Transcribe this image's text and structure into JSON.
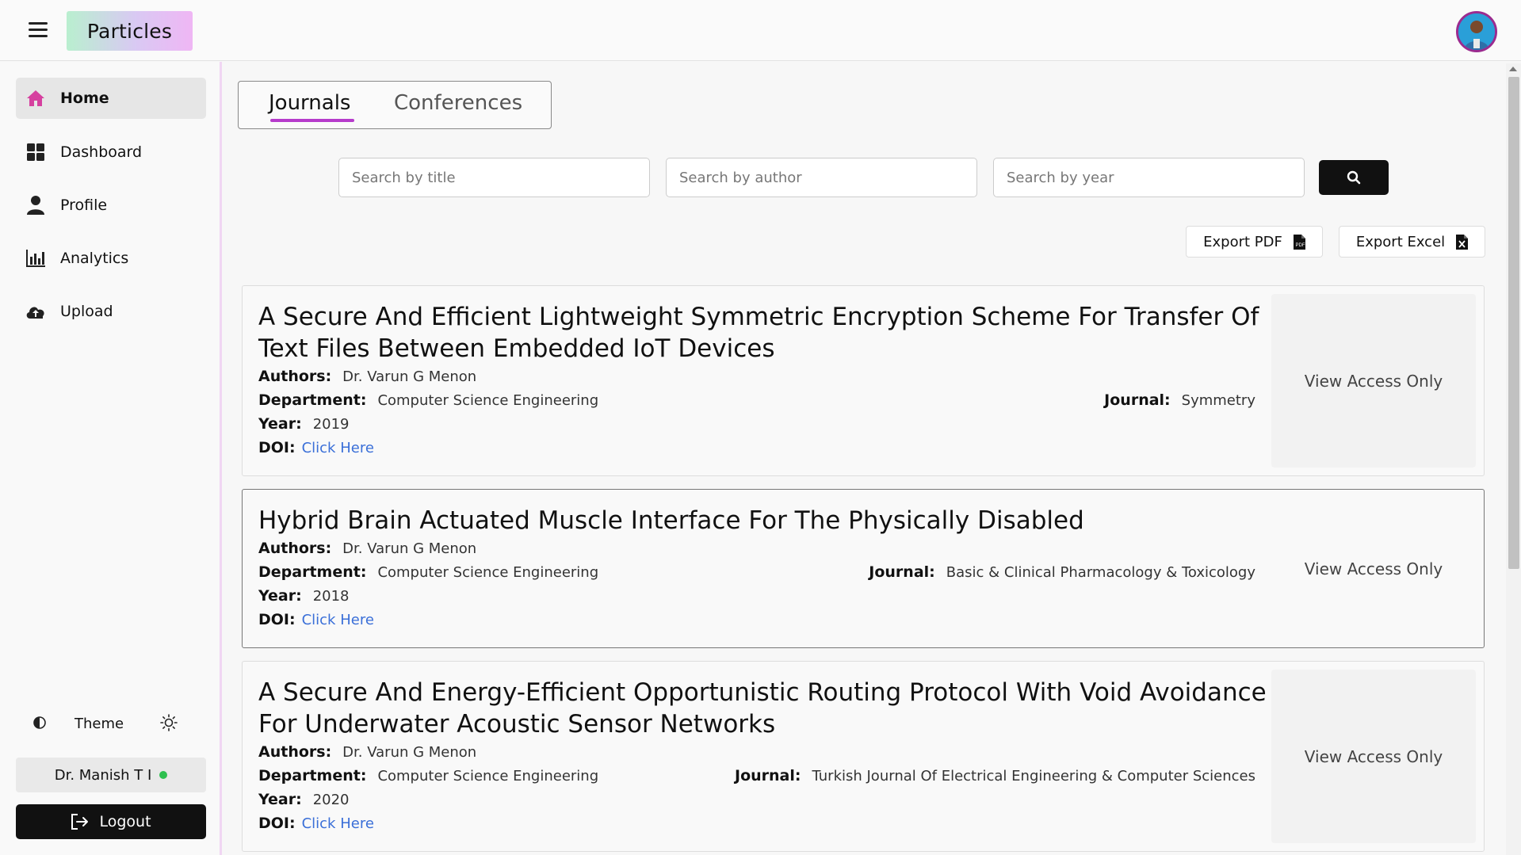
{
  "app": {
    "logo_text": "Particles"
  },
  "header": {
    "menu_icon": "hamburger-icon",
    "avatar": "user-avatar"
  },
  "sidebar": {
    "items": [
      {
        "label": "Home",
        "icon": "home-icon",
        "active": true
      },
      {
        "label": "Dashboard",
        "icon": "dashboard-icon",
        "active": false
      },
      {
        "label": "Profile",
        "icon": "person-icon",
        "active": false
      },
      {
        "label": "Analytics",
        "icon": "bar-chart-icon",
        "active": false
      },
      {
        "label": "Upload",
        "icon": "cloud-upload-icon",
        "active": false
      }
    ],
    "theme_label": "Theme",
    "user_name": "Dr. Manish T I",
    "logout_label": "Logout"
  },
  "tabs": [
    {
      "label": "Journals",
      "active": true
    },
    {
      "label": "Conferences",
      "active": false
    }
  ],
  "search": {
    "title_placeholder": "Search by title",
    "author_placeholder": "Search by author",
    "year_placeholder": "Search by year"
  },
  "export": {
    "pdf_label": "Export PDF",
    "excel_label": "Export Excel"
  },
  "labels": {
    "authors": "Authors:",
    "department": "Department:",
    "year": "Year:",
    "doi": "DOI:",
    "journal": "Journal:"
  },
  "papers": [
    {
      "title": "A Secure And Efficient Lightweight Symmetric Encryption Scheme For Transfer Of Text Files Between Embedded IoT Devices",
      "authors": "Dr. Varun G Menon",
      "department": "Computer Science Engineering",
      "year": "2019",
      "doi_link": "Click Here",
      "journal": "Symmetry",
      "access": "View Access Only"
    },
    {
      "title": "Hybrid Brain Actuated Muscle Interface For The Physically Disabled",
      "authors": "Dr. Varun G Menon",
      "department": "Computer Science Engineering",
      "year": "2018",
      "doi_link": "Click Here",
      "journal": "Basic & Clinical Pharmacology & Toxicology",
      "access": "View Access Only"
    },
    {
      "title": "A Secure And Energy-Efficient Opportunistic Routing Protocol With Void Avoidance For Underwater Acoustic Sensor Networks",
      "authors": "Dr. Varun G Menon",
      "department": "Computer Science Engineering",
      "year": "2020",
      "doi_link": "Click Here",
      "journal": "Turkish Journal Of Electrical Engineering & Computer Sciences",
      "access": "View Access Only"
    }
  ],
  "colors": {
    "accent": "#b63bcb",
    "link": "#3a6fd8",
    "home_icon": "#d6409f",
    "online": "#2ec04f"
  }
}
